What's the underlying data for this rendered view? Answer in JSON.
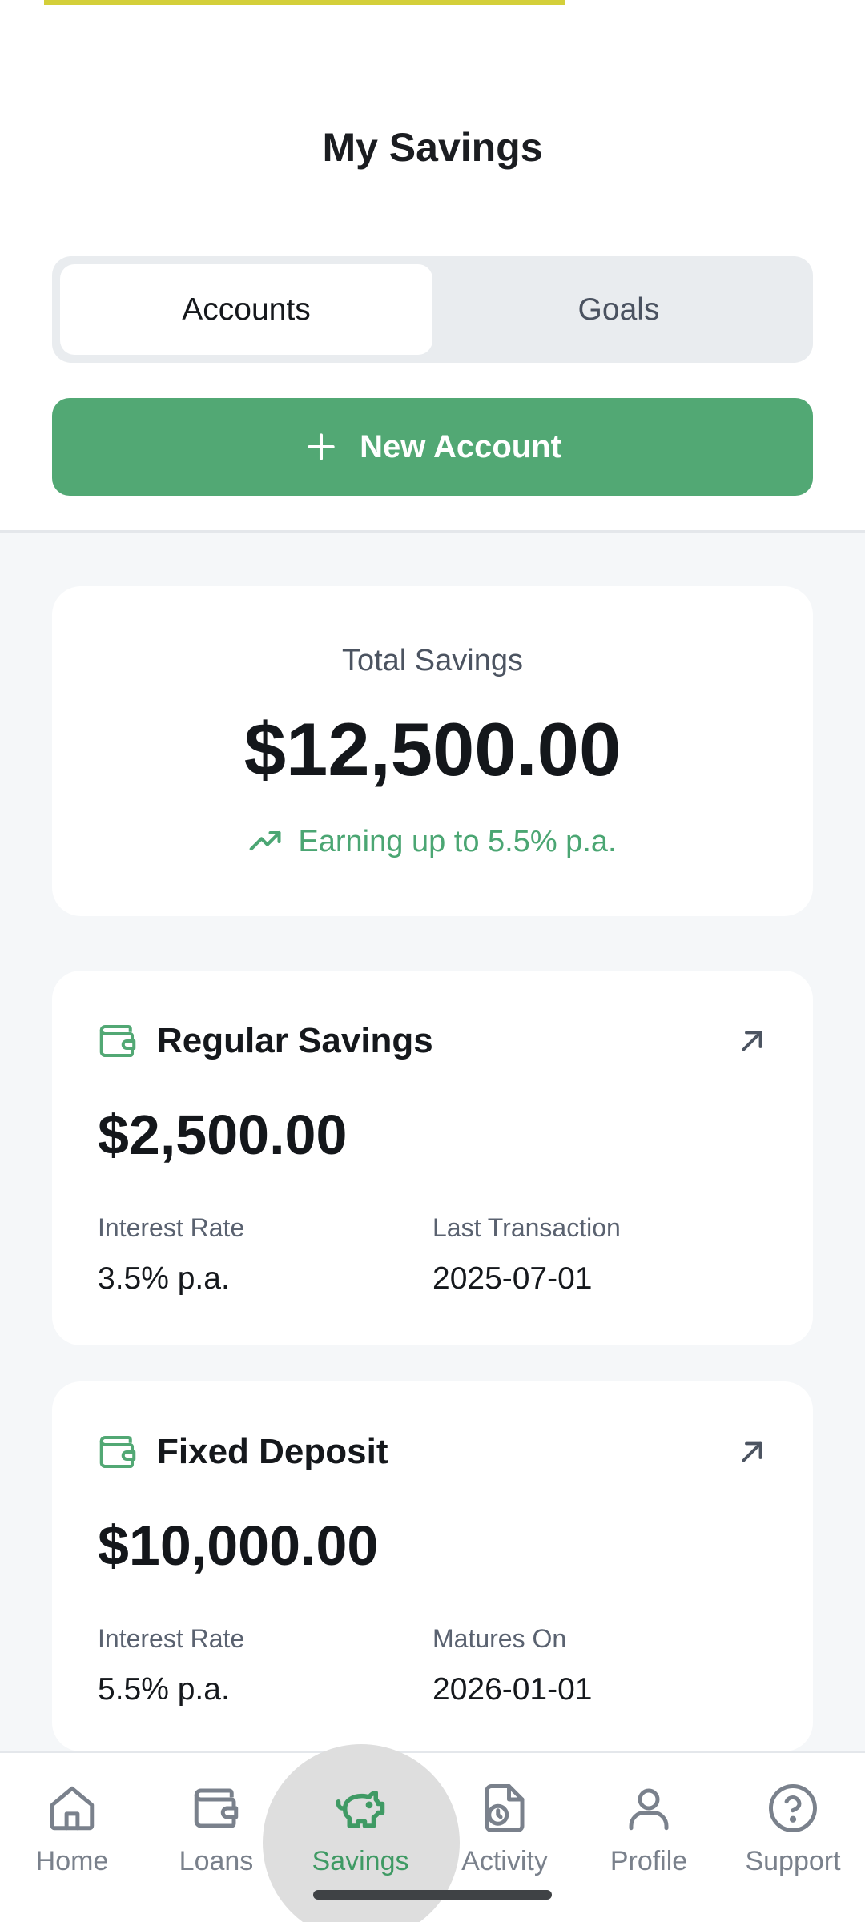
{
  "header": {
    "title": "My Savings",
    "tabs": [
      {
        "label": "Accounts",
        "active": true
      },
      {
        "label": "Goals",
        "active": false
      }
    ],
    "new_account_label": "New Account",
    "new_account_icon": "plus-icon"
  },
  "summary": {
    "label": "Total Savings",
    "amount": "$12,500.00",
    "earning_text": "Earning up to 5.5% p.a.",
    "earning_icon": "trending-up-icon"
  },
  "accounts": [
    {
      "name": "Regular Savings",
      "icon": "wallet-icon",
      "amount": "$2,500.00",
      "meta1_label": "Interest Rate",
      "meta1_value": "3.5% p.a.",
      "meta2_label": "Last Transaction",
      "meta2_value": "2025-07-01"
    },
    {
      "name": "Fixed Deposit",
      "icon": "wallet-icon",
      "amount": "$10,000.00",
      "meta1_label": "Interest Rate",
      "meta1_value": "5.5% p.a.",
      "meta2_label": "Matures On",
      "meta2_value": "2026-01-01"
    }
  ],
  "nav": {
    "items": [
      {
        "label": "Home",
        "icon": "home-icon"
      },
      {
        "label": "Loans",
        "icon": "wallet-icon"
      },
      {
        "label": "Savings",
        "icon": "piggy-bank-icon",
        "active": true
      },
      {
        "label": "Activity",
        "icon": "file-clock-icon"
      },
      {
        "label": "Profile",
        "icon": "user-icon"
      },
      {
        "label": "Support",
        "icon": "help-circle-icon"
      }
    ]
  },
  "colors": {
    "accent": "#52a874",
    "accent_text": "#3f9a64",
    "progress_bar": "#d4cf3a",
    "background": "#f5f7f9"
  }
}
